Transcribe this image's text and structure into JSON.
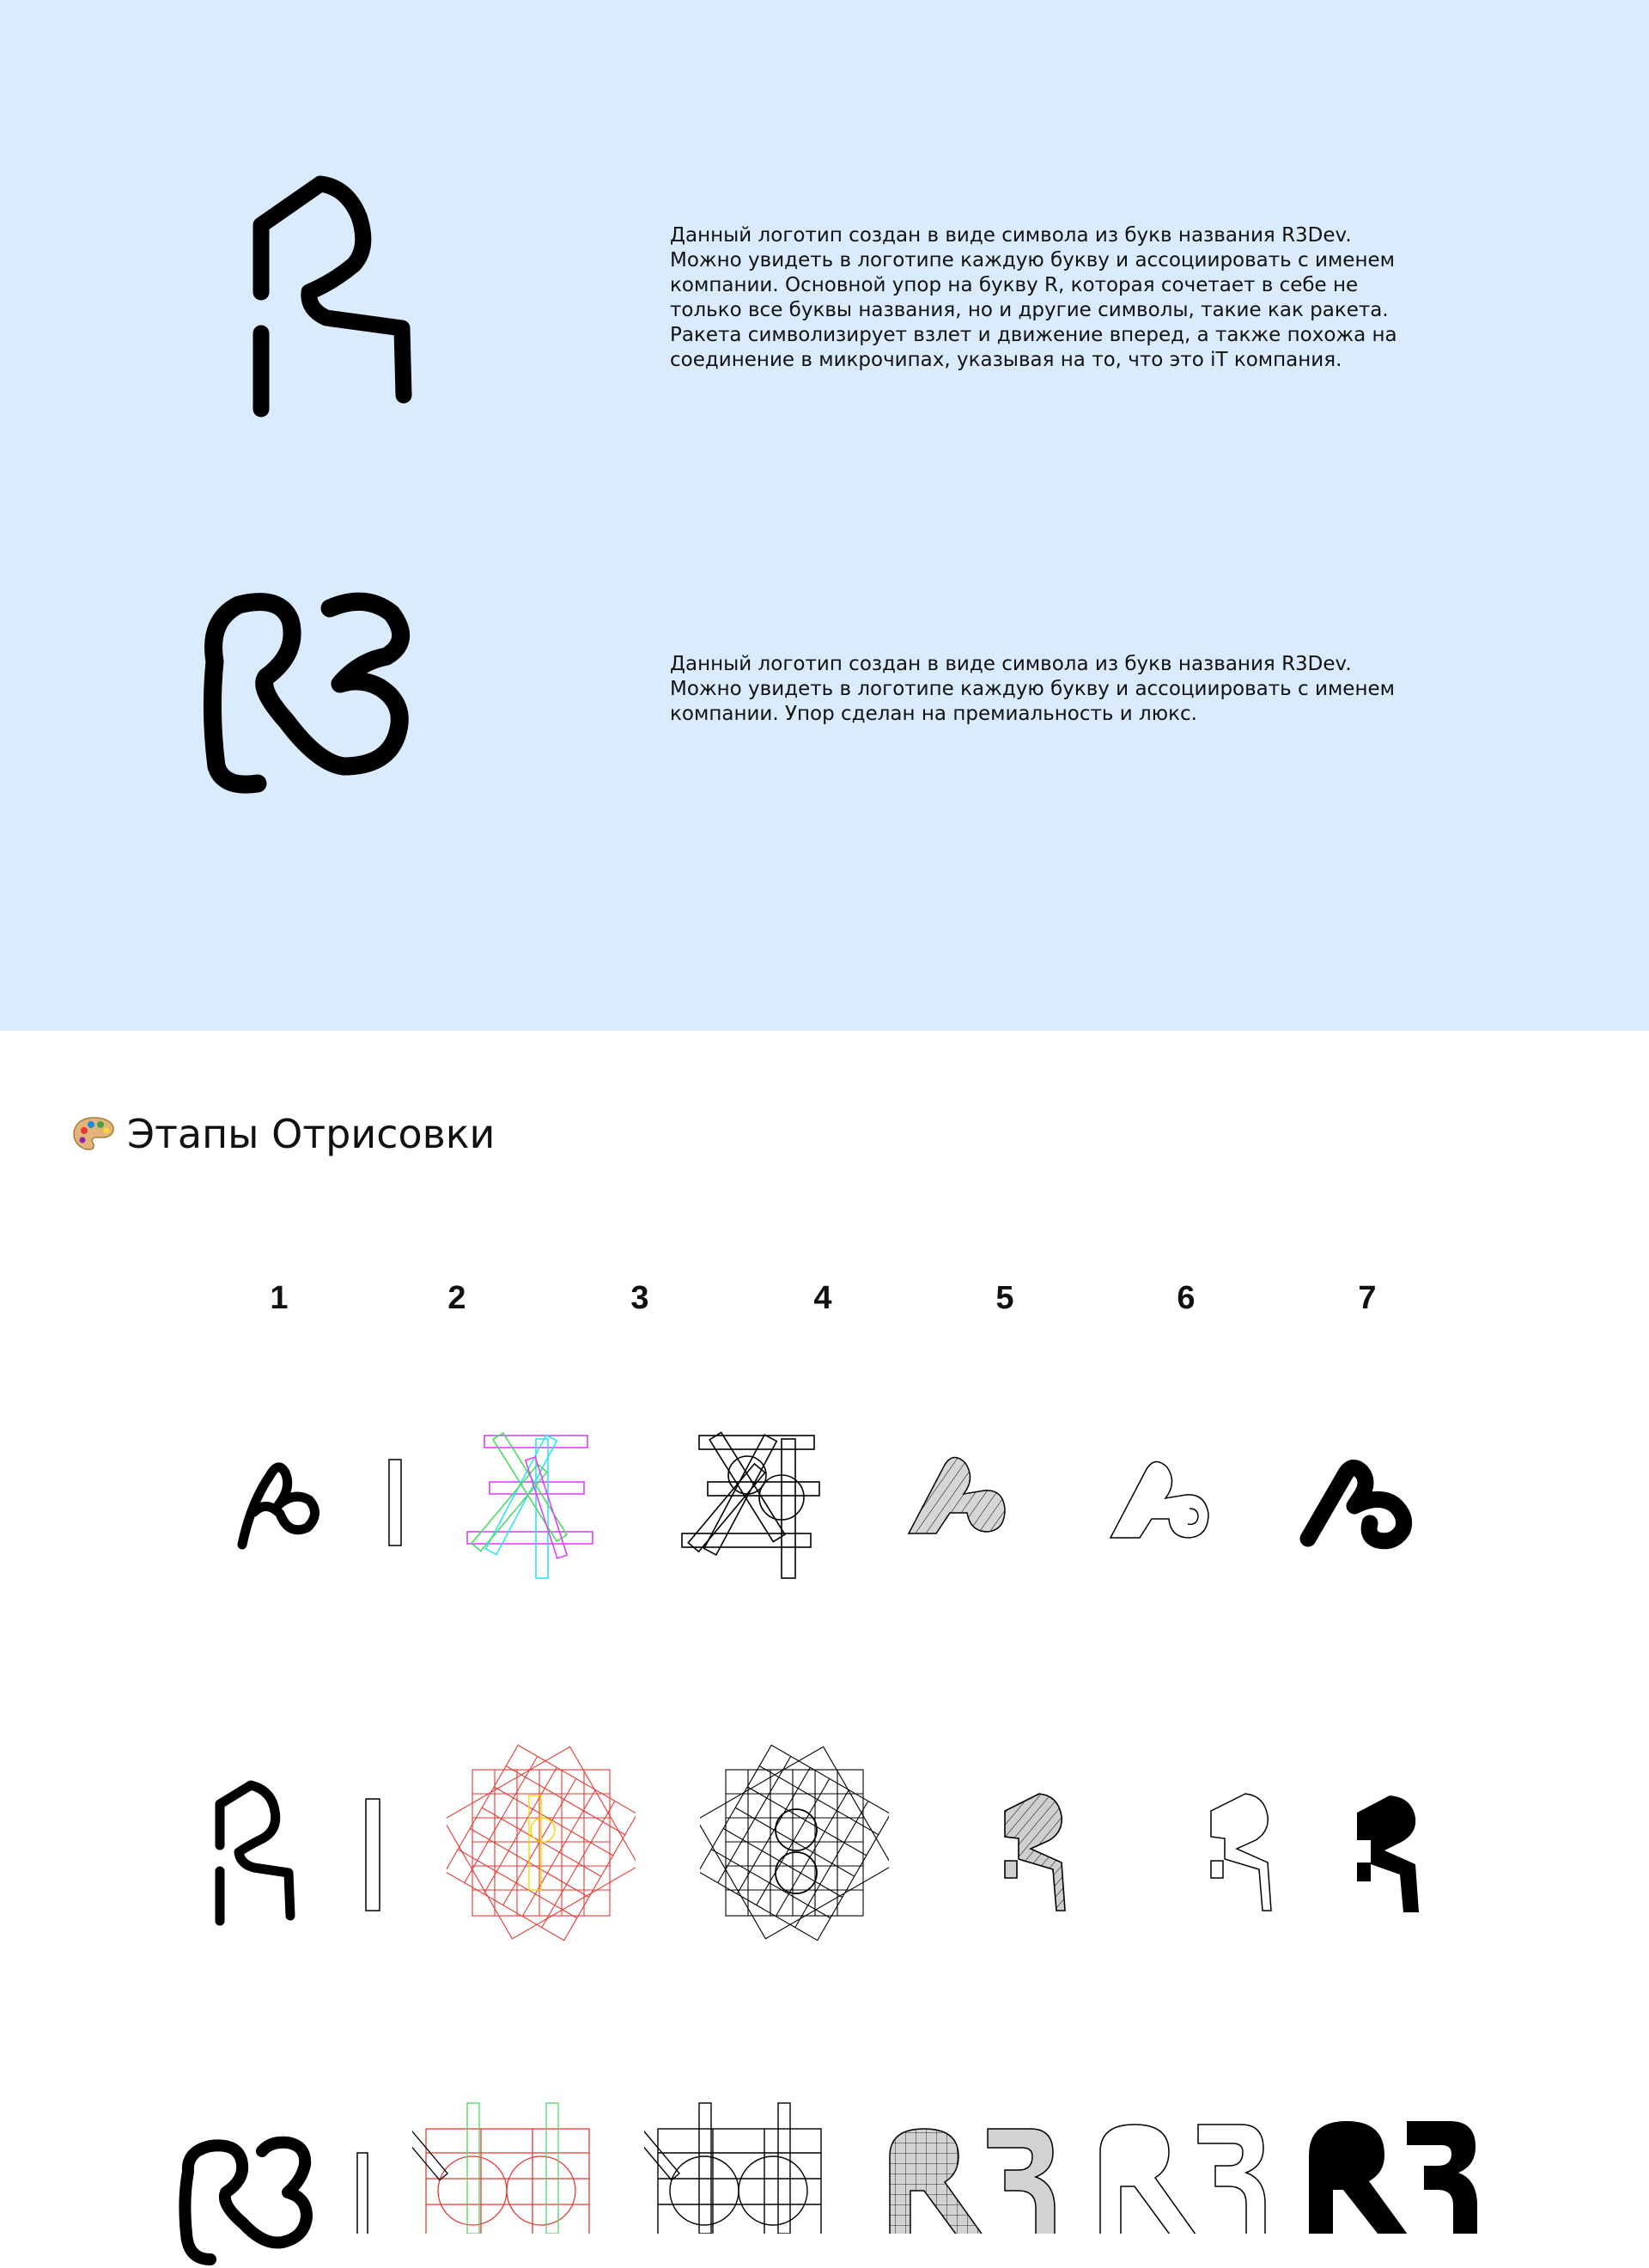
{
  "colors": {
    "panel_background": "#d9ebfd",
    "ink": "#000000",
    "grid_magenta": "#e040fb",
    "grid_cyan": "#31e3f0",
    "grid_green": "#4cd964",
    "grid_red": "#e53935",
    "grid_yellow": "#f2d600"
  },
  "concepts": [
    {
      "icon": "r-rocket-sketch-logo",
      "description": "Данный логотип создан в виде символа из букв названия R3Dev. Можно увидеть в логотипе каждую букву и ассоциировать с именем компании. Основной упор на букву R, которая сочетает в себе не только все буквы названия, но и другие символы, такие как ракета. Ракета символизирует взлет и движение вперед, а также похожа на соединение в микрочипах, указывая на то, что это iT компания."
    },
    {
      "icon": "r3-sketch-logo",
      "description": "Данный логотип создан в виде символа из букв названия R3Dev. Можно увидеть в логотипе каждую букву и ассоциировать с именем компании. Упор сделан на премиальность и люкс."
    }
  ],
  "stages_section": {
    "icon": "palette-icon",
    "title": "Этапы Отрисовки",
    "step_numbers": [
      "1",
      "2",
      "3",
      "4",
      "5",
      "6",
      "7"
    ],
    "rows": [
      {
        "name": "rb-logo-stages"
      },
      {
        "name": "r-rocket-logo-stages"
      },
      {
        "name": "r3-logo-stages"
      }
    ]
  }
}
